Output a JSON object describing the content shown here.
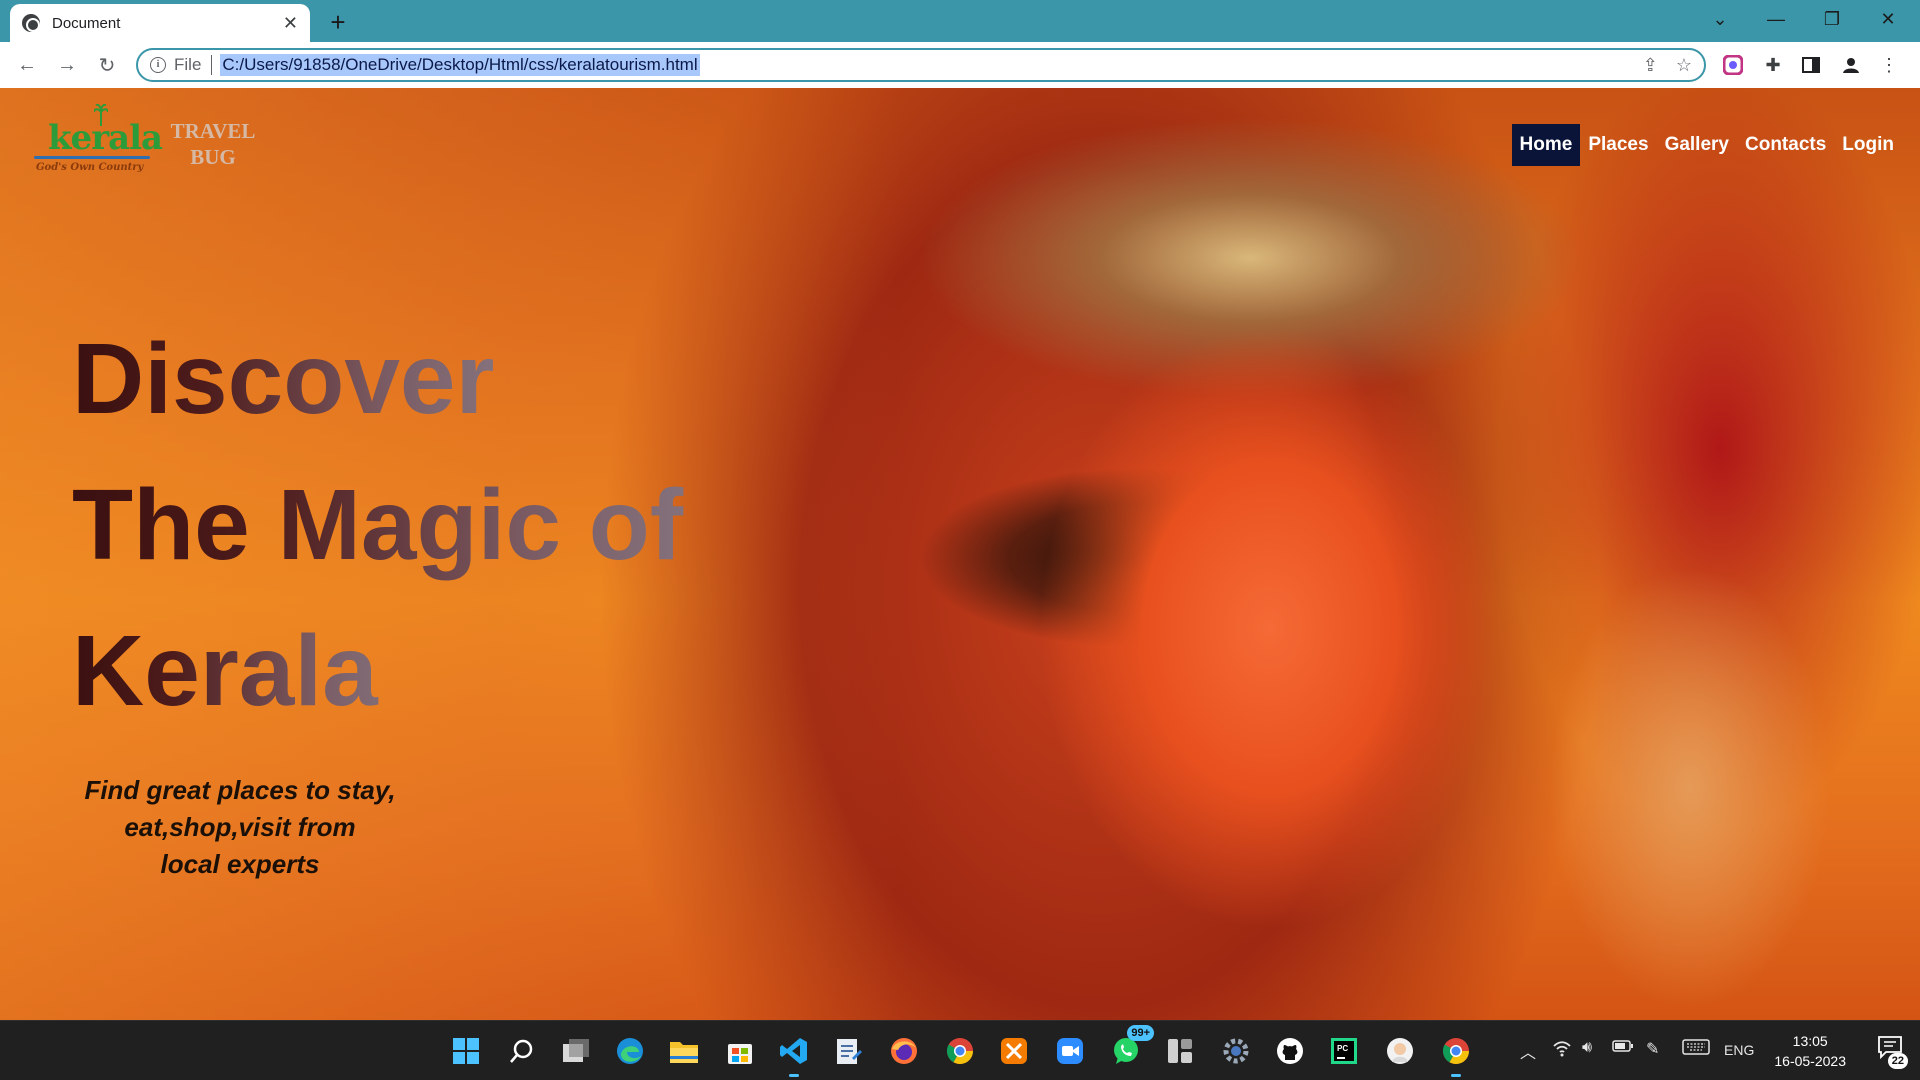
{
  "browser": {
    "tab_title": "Document",
    "close_glyph": "✕",
    "new_tab_glyph": "+",
    "url_scheme_label": "File",
    "url": "C:/Users/91858/OneDrive/Desktop/Html/css/keralatourism.html",
    "accent_color": "#3a96a8"
  },
  "page": {
    "logo": {
      "word": "kerala",
      "tagline": "God's Own Country"
    },
    "brand": {
      "line1": "TRAVEL",
      "line2": "BUG"
    },
    "nav": [
      {
        "label": "Home",
        "active": true
      },
      {
        "label": "Places",
        "active": false
      },
      {
        "label": "Gallery",
        "active": false
      },
      {
        "label": "Contacts",
        "active": false
      },
      {
        "label": "Login",
        "active": false
      }
    ],
    "hero": {
      "line1": "Discover",
      "line2": "The Magic of",
      "line3": "Kerala"
    },
    "tagline": {
      "line1": "Find great places to stay,",
      "line2": "eat,shop,visit from",
      "line3": "local experts"
    }
  },
  "taskbar": {
    "apps": [
      "start-icon",
      "search-icon",
      "task-view-icon",
      "edge-icon",
      "file-explorer-icon",
      "store-icon",
      "vscode-icon",
      "notepad-icon",
      "firefox-icon",
      "chrome-icon",
      "app-icon",
      "zoom-icon",
      "whatsapp-icon",
      "widgets-icon",
      "settings-icon",
      "github-icon",
      "pycharm-icon",
      "avatar-app-icon",
      "chrome-active-icon"
    ],
    "whatsapp_badge": "99+",
    "language": "ENG",
    "time": "13:05",
    "date": "16-05-2023",
    "notification_count": "22"
  }
}
